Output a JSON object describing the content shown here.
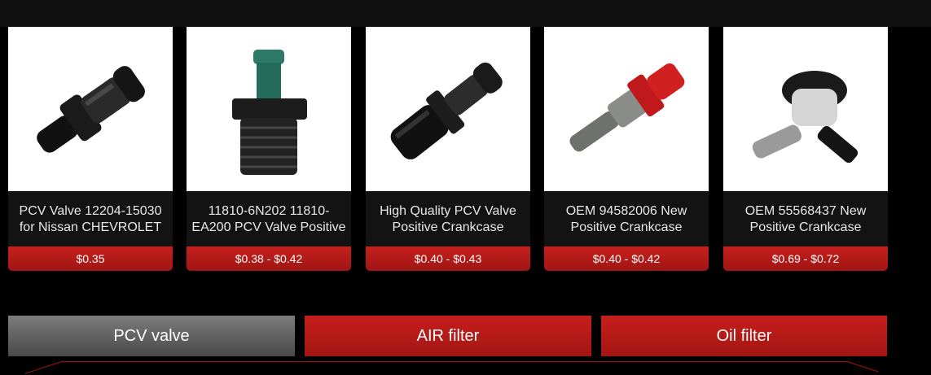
{
  "products": [
    {
      "title": "PCV Valve 12204-15030 for Nissan CHEVROLET",
      "price": "$0.35",
      "image_icon": "pcv-valve-black-icon"
    },
    {
      "title": "11810-6N202 11810-EA200 PCV Valve Positive",
      "price": "$0.38 - $0.42",
      "image_icon": "pcv-valve-green-threaded-icon"
    },
    {
      "title": "High Quality PCV Valve Positive Crankcase",
      "price": "$0.40 - $0.43",
      "image_icon": "pcv-valve-black-angled-icon"
    },
    {
      "title": "OEM 94582006 New Positive Crankcase",
      "price": "$0.40 - $0.42",
      "image_icon": "pcv-valve-red-grey-icon"
    },
    {
      "title": "OEM 55568437 New Positive Crankcase",
      "price": "$0.69 - $0.72",
      "image_icon": "pcv-valve-elbow-icon"
    }
  ],
  "tabs": [
    {
      "label": "PCV valve",
      "active": true
    },
    {
      "label": "AIR filter",
      "active": false
    },
    {
      "label": "Oil filter",
      "active": false
    }
  ],
  "colors": {
    "accent_red": "#b81a17",
    "active_tab_grey": "#5f5f5f",
    "background": "#000000"
  }
}
